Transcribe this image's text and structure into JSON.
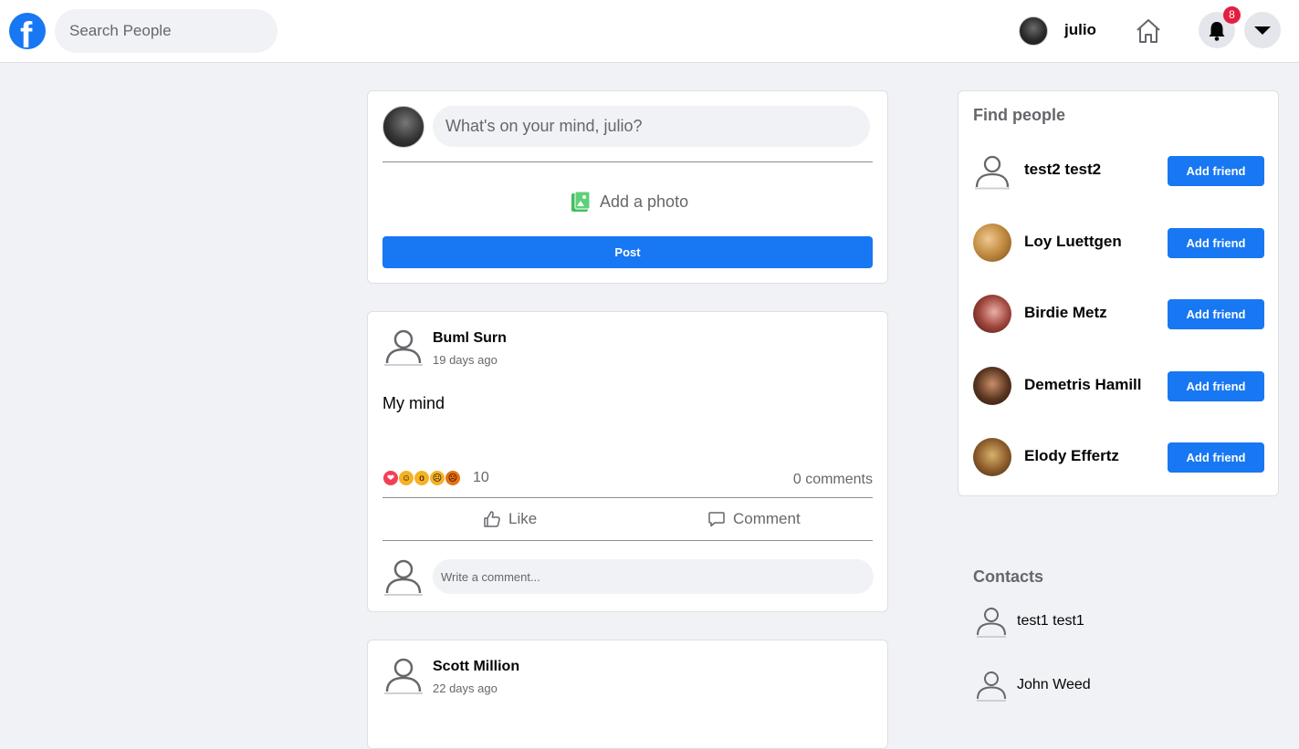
{
  "header": {
    "logo_letter": "f",
    "search_placeholder": "Search People",
    "user_name": "julio",
    "notification_count": "8"
  },
  "composer": {
    "placeholder": "What's on your mind, julio?",
    "add_photo_label": "Add a photo",
    "post_label": "Post"
  },
  "posts": [
    {
      "author": "Buml Surn",
      "time": "19 days ago",
      "text": "My mind",
      "reactions": [
        "love",
        "haha",
        "wow",
        "sad",
        "angry"
      ],
      "reaction_count": "10",
      "comments": "0 comments",
      "like_label": "Like",
      "comment_label": "Comment",
      "comment_placeholder": "Write a comment..."
    },
    {
      "author": "Scott Million",
      "time": "22 days ago"
    }
  ],
  "find_people": {
    "title": "Find people",
    "button_label": "Add friend",
    "people": [
      {
        "name": "test2 test2"
      },
      {
        "name": "Loy Luettgen"
      },
      {
        "name": "Birdie Metz"
      },
      {
        "name": "Demetris Hamill"
      },
      {
        "name": "Elody Effertz"
      }
    ]
  },
  "contacts": {
    "title": "Contacts",
    "items": [
      {
        "name": "test1 test1"
      },
      {
        "name": "John Weed"
      }
    ]
  },
  "colors": {
    "brand": "#1877f2",
    "badge": "#e41e3f",
    "background": "#f0f2f5"
  }
}
